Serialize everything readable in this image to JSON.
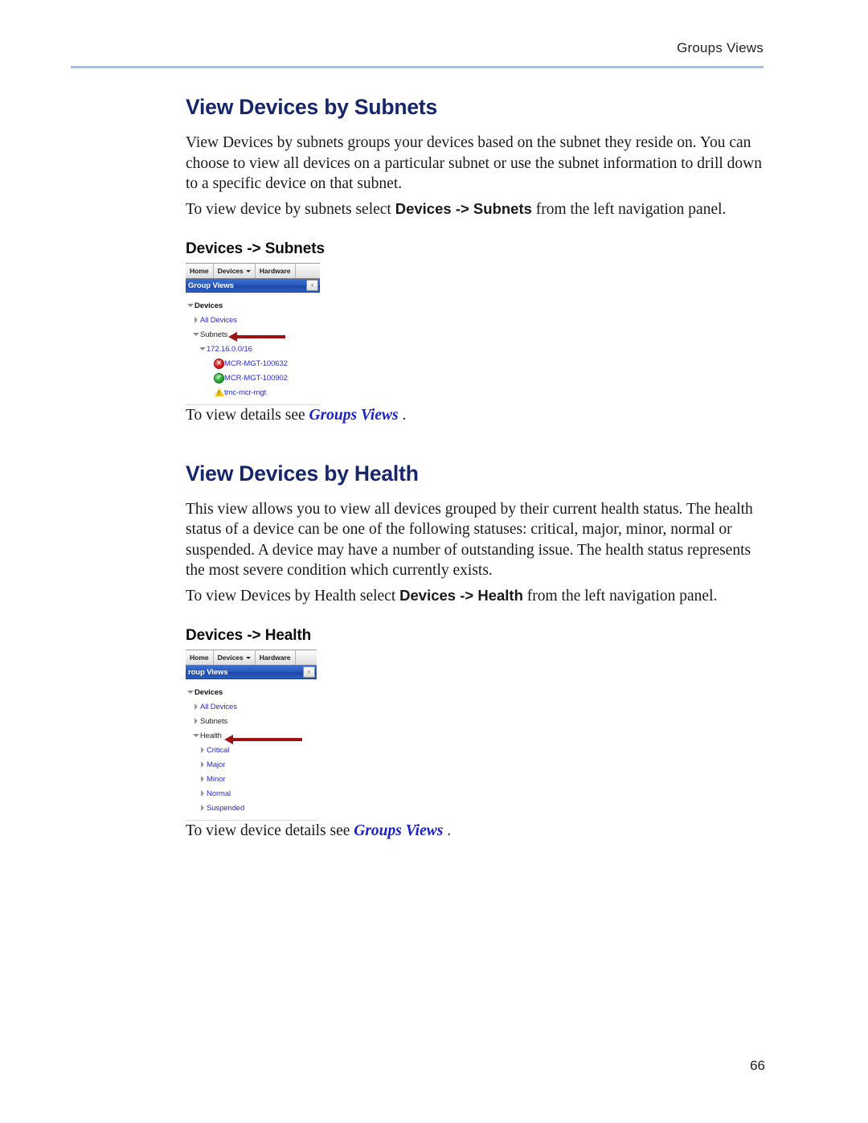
{
  "page": {
    "running_header": "Groups Views",
    "page_number": "66"
  },
  "sections": [
    {
      "title": "View Devices by Subnets",
      "paragraph": "View Devices by subnets groups your devices based on the subnet they reside on. You can choose to view all devices on a particular subnet or use the subnet information to drill down to a specific device on that subnet.",
      "instruction_prefix": "To view device by subnets select ",
      "instruction_bold": "Devices -> Subnets",
      "instruction_suffix": " from the left navigation panel.",
      "figure_title": "Devices -> Subnets",
      "caption_prefix": "To view details see ",
      "caption_link": "Groups Views",
      "caption_suffix": " ."
    },
    {
      "title": "View Devices by Health",
      "paragraph": "This view allows you to view all devices grouped by their current health status. The health status of a device can be one of the following statuses: critical, major, minor, normal or suspended. A device may have a number of outstanding issue. The health status represents the most severe condition which currently exists.",
      "instruction_prefix": "To view Devices by Health select ",
      "instruction_bold": "Devices -> Health",
      "instruction_suffix": " from the left navigation panel.",
      "figure_title": "Devices -> Health",
      "caption_prefix": "To view device details see ",
      "caption_link": "Groups Views",
      "caption_suffix": " ."
    }
  ],
  "screenshot_subnets": {
    "tabs": [
      {
        "label": "Home",
        "has_caret": false
      },
      {
        "label": "Devices",
        "has_caret": true
      },
      {
        "label": "Hardware",
        "has_caret": false
      }
    ],
    "panel_title": "Group Views",
    "collapse_label": "‹",
    "tree": [
      {
        "label": "Devices",
        "style": "root",
        "indent": 0,
        "twisty": "down",
        "icon": "none"
      },
      {
        "label": "All Devices",
        "style": "link",
        "indent": 1,
        "twisty": "right",
        "icon": "none"
      },
      {
        "label": "Subnets",
        "style": "plain",
        "indent": 1,
        "twisty": "down",
        "icon": "none"
      },
      {
        "label": "172.16.0.0/16",
        "style": "link",
        "indent": 2,
        "twisty": "down",
        "icon": "none"
      },
      {
        "label": "MCR-MGT-100632",
        "style": "link",
        "indent": 3,
        "twisty": "none",
        "icon": "status-critical-icon"
      },
      {
        "label": "MCR-MGT-100902",
        "style": "link",
        "indent": 3,
        "twisty": "none",
        "icon": "status-normal-icon"
      },
      {
        "label": "tmc-mcr-mgt",
        "style": "link",
        "indent": 3,
        "twisty": "none",
        "icon": "status-warning-icon"
      }
    ]
  },
  "screenshot_health": {
    "tabs": [
      {
        "label": "Home",
        "has_caret": false
      },
      {
        "label": "Devices",
        "has_caret": true
      },
      {
        "label": "Hardware",
        "has_caret": false
      }
    ],
    "panel_title": "roup Views",
    "collapse_label": "‹",
    "tree": [
      {
        "label": "Devices",
        "style": "root",
        "indent": 0,
        "twisty": "down",
        "icon": "none"
      },
      {
        "label": "All Devices",
        "style": "link",
        "indent": 1,
        "twisty": "right",
        "icon": "none"
      },
      {
        "label": "Subnets",
        "style": "plain",
        "indent": 1,
        "twisty": "right",
        "icon": "none"
      },
      {
        "label": "Health",
        "style": "plain",
        "indent": 1,
        "twisty": "down",
        "icon": "none"
      },
      {
        "label": "Critical",
        "style": "link",
        "indent": 2,
        "twisty": "right",
        "icon": "none"
      },
      {
        "label": "Major",
        "style": "link",
        "indent": 2,
        "twisty": "right",
        "icon": "none"
      },
      {
        "label": "Minor",
        "style": "link",
        "indent": 2,
        "twisty": "right",
        "icon": "none"
      },
      {
        "label": "Normal",
        "style": "link",
        "indent": 2,
        "twisty": "right",
        "icon": "none"
      },
      {
        "label": "Suspended",
        "style": "link",
        "indent": 2,
        "twisty": "right",
        "icon": "none"
      }
    ]
  },
  "colors": {
    "heading_blue": "#16266b",
    "link_blue": "#2b2bd6",
    "xref_blue": "#1a22c8",
    "panel_bar_blue": "#2b59bb",
    "callout_red": "#9c1313",
    "rule_blue": "#aebedd"
  }
}
